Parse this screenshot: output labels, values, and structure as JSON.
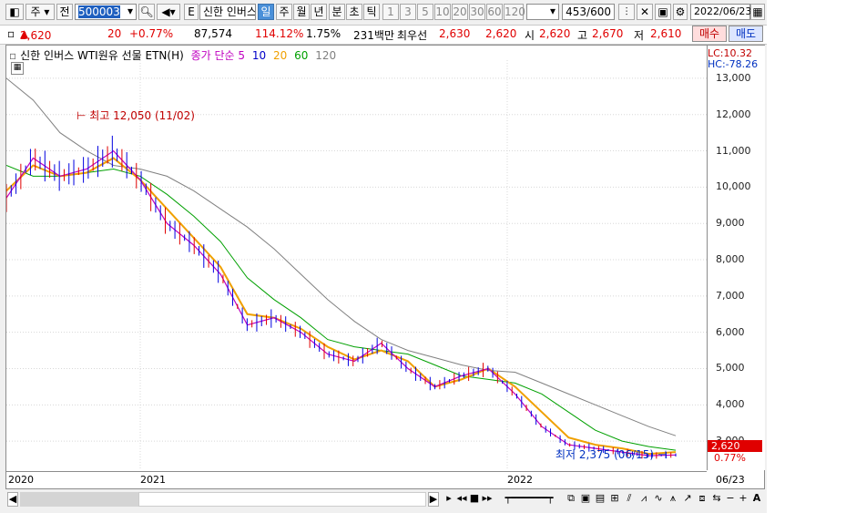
{
  "toolbar": {
    "type_label": "주",
    "all_label": "전",
    "code_value": "500003",
    "e_label": "E",
    "stock_name": "신한 인버스",
    "periods": [
      "일",
      "주",
      "월",
      "년",
      "분",
      "초",
      "틱"
    ],
    "selected_period": "일",
    "intervals": [
      "1",
      "3",
      "5",
      "10",
      "20",
      "30",
      "60",
      "120"
    ],
    "count": "453",
    "count_total": "/600",
    "date": "2022/06/23"
  },
  "info": {
    "price": "2,620",
    "change": "20",
    "change_pct": "+0.77%",
    "volume": "87,574",
    "vol_ratio": "114.12%",
    "turnover": "1.75%",
    "amount": "231백만",
    "best_label": "최우선",
    "ask": "2,630",
    "bid": "2,620",
    "open_label": "시",
    "open": "2,620",
    "high_label": "고",
    "high": "2,670",
    "low_label": "저",
    "low": "2,610",
    "buy_label": "매수",
    "sell_label": "매도"
  },
  "legend": {
    "title": "신한 인버스 WTI원유 선물 ETN(H)",
    "ma_label": "종가 단순 5",
    "ma10": "10",
    "ma20": "20",
    "ma60": "60",
    "ma120": "120"
  },
  "axis": {
    "lc": "LC:10.32",
    "hc": "HC:-78.26",
    "yticks": [
      "13,000",
      "12,000",
      "11,000",
      "10,000",
      "9,000",
      "8,000",
      "7,000",
      "6,000",
      "5,000",
      "4,000",
      "3,000"
    ],
    "cur_price": "2,620",
    "cur_pct": "0.77%",
    "xticks": [
      "2020",
      "2021",
      "2022"
    ],
    "last_date": "06/23"
  },
  "annotations": {
    "high": "최고 12,050 (11/02)",
    "low": "최저 2,375 (06/15)"
  },
  "colors": {
    "ma5": "#c000c0",
    "ma10": "#0000c8",
    "ma20": "#f0a000",
    "ma60": "#00a000",
    "ma120": "#808080",
    "up": "#e00000",
    "down": "#0000e0"
  },
  "chart_data": {
    "type": "line",
    "series": [
      {
        "name": "5",
        "values": [
          9700,
          10800,
          10300,
          10500,
          11000,
          10200,
          9000,
          8400,
          7600,
          6200,
          6400,
          6000,
          5400,
          5200,
          5700,
          5000,
          4500,
          4800,
          5000,
          4300,
          3400,
          2900,
          2800,
          2700,
          2600,
          2620
        ]
      },
      {
        "name": "20",
        "values": [
          9900,
          10600,
          10300,
          10400,
          10800,
          10200,
          9400,
          8600,
          7800,
          6500,
          6400,
          6100,
          5600,
          5250,
          5500,
          5200,
          4500,
          4700,
          5000,
          4500,
          3800,
          3100,
          2900,
          2800,
          2650,
          2700
        ]
      },
      {
        "name": "60",
        "values": [
          10600,
          10300,
          10300,
          10400,
          10500,
          10300,
          9800,
          9200,
          8500,
          7500,
          6900,
          6400,
          5800,
          5600,
          5500,
          5400,
          5100,
          4800,
          4700,
          4600,
          4300,
          3800,
          3300,
          3000,
          2850,
          2750
        ]
      },
      {
        "name": "120",
        "values": [
          13000,
          12400,
          11500,
          11000,
          10600,
          10500,
          10300,
          9900,
          9400,
          8900,
          8300,
          7600,
          6900,
          6300,
          5800,
          5500,
          5300,
          5100,
          4950,
          4900,
          4600,
          4300,
          4000,
          3700,
          3400,
          3150
        ]
      }
    ],
    "ylim": [
      2200,
      13500
    ]
  }
}
